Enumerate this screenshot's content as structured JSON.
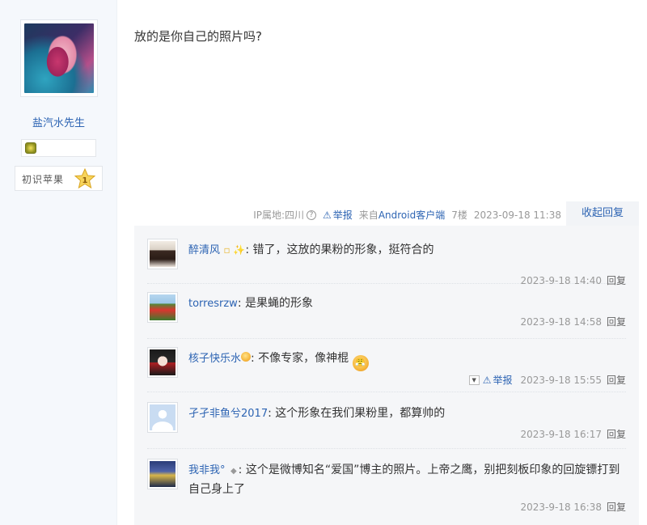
{
  "author": {
    "name": "盐汽水先生",
    "level_label": "初识苹果",
    "level_number": "1"
  },
  "post": {
    "content": "放的是你自己的照片吗?",
    "ip_label": "IP属地:四川",
    "report_label": "举报",
    "client_prefix": "来自",
    "client_name": "Android客户端",
    "floor": "7楼",
    "datetime": "2023-09-18 11:38",
    "collapse_label": "收起回复"
  },
  "comments": [
    {
      "name": "醉清风",
      "suffix_icons": "▫ ✨",
      "text": ": 错了，这放的果粉的形象，挺符合的",
      "time": "2023-9-18 14:40",
      "reply": "回复"
    },
    {
      "name": "torresrzw",
      "text": ": 是果蝇的形象",
      "time": "2023-9-18 14:58",
      "reply": "回复"
    },
    {
      "name": "核子快乐水",
      "text": ": 不像专家，像神棍",
      "time": "2023-9-18 15:55",
      "reply": "回复",
      "report": "举报"
    },
    {
      "name": "孑孑非鱼兮2017",
      "text": ": 这个形象在我们果粉里，都算帅的",
      "time": "2023-9-18 16:17",
      "reply": "回复"
    },
    {
      "name": "我非我°",
      "text": ": 这个是微博知名“爱国”博主的照片。上帝之鹰，别把刻板印象的回旋镖打到自己身上了",
      "time": "2023-9-18 16:38",
      "reply": "回复"
    }
  ],
  "colors": {
    "link": "#2d64b3",
    "meta": "#999999",
    "sidebar_bg": "#f5f8fc",
    "comments_bg": "#f5f6f8"
  }
}
